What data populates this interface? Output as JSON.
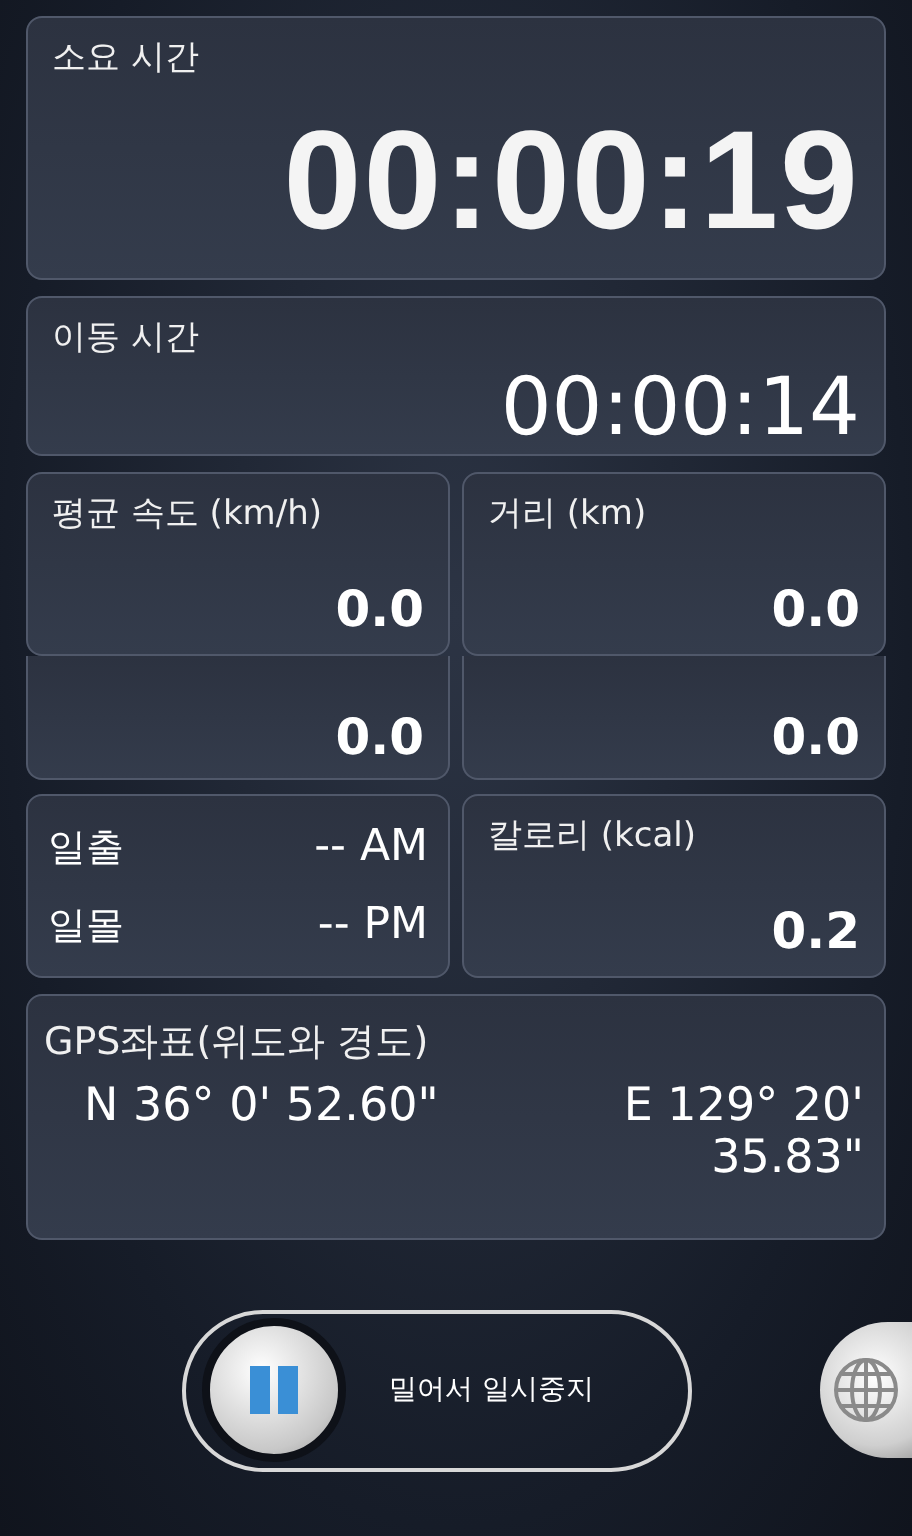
{
  "timers": [
    {
      "kind": "large",
      "label": "소요 시간",
      "value": "00:00:19"
    },
    {
      "kind": "medium",
      "label": "이동 시간",
      "value": "00:00:14"
    }
  ],
  "stats": [
    {
      "kind": "stat",
      "label": "평균 속도 (km/h)",
      "value": "0.0"
    },
    {
      "kind": "stat",
      "label": "거리 (km)",
      "value": "0.0"
    },
    {
      "kind": "covered",
      "value": "0.0"
    },
    {
      "kind": "covered",
      "value": "0.0"
    },
    {
      "kind": "sun",
      "rows": [
        {
          "label": "일출",
          "value": "-- AM"
        },
        {
          "label": "일몰",
          "value": "-- PM"
        }
      ]
    },
    {
      "kind": "stat",
      "label": "칼로리 (kcal)",
      "value": "0.2"
    }
  ],
  "gps": {
    "label": "GPS좌표(위도와 경도)",
    "latitude": "N 36° 0' 52.60\"",
    "longitude": "E 129° 20' 35.83\""
  },
  "pause_slider": {
    "label": "밀어서 일시중지",
    "level": 0
  }
}
